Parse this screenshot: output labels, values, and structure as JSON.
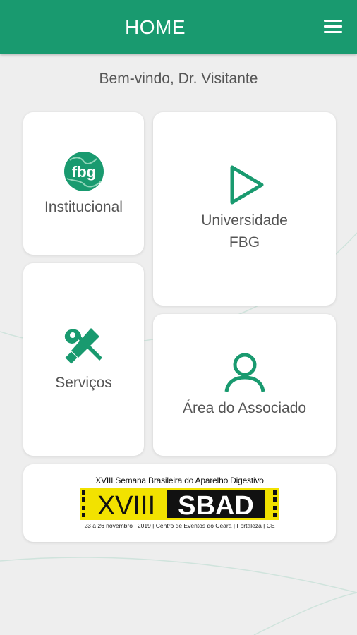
{
  "app": {
    "title": "HOME",
    "menu_icon": "hamburger-menu-icon"
  },
  "welcome": "Bem-vindo, Dr. Visitante",
  "tiles": {
    "institucional": {
      "label": "Institucional",
      "icon": "fbg-globe-logo-icon"
    },
    "universidade": {
      "label_line1": "Universidade",
      "label_line2": "FBG",
      "icon": "play-icon"
    },
    "servicos": {
      "label": "Serviços",
      "icon": "tools-icon"
    },
    "associado": {
      "label": "Área do Associado",
      "icon": "user-icon"
    }
  },
  "banner": {
    "headline": "XVIII Semana Brasileira do Aparelho Digestivo",
    "logo_left": "XVIII",
    "logo_right": "SBAD",
    "details": "23 a 26 novembro | 2019 | Centro de Eventos do Ceará | Fortaleza | CE"
  },
  "colors": {
    "primary": "#199a6f",
    "background": "#eeeeee",
    "banner_yellow": "#f2e200"
  }
}
